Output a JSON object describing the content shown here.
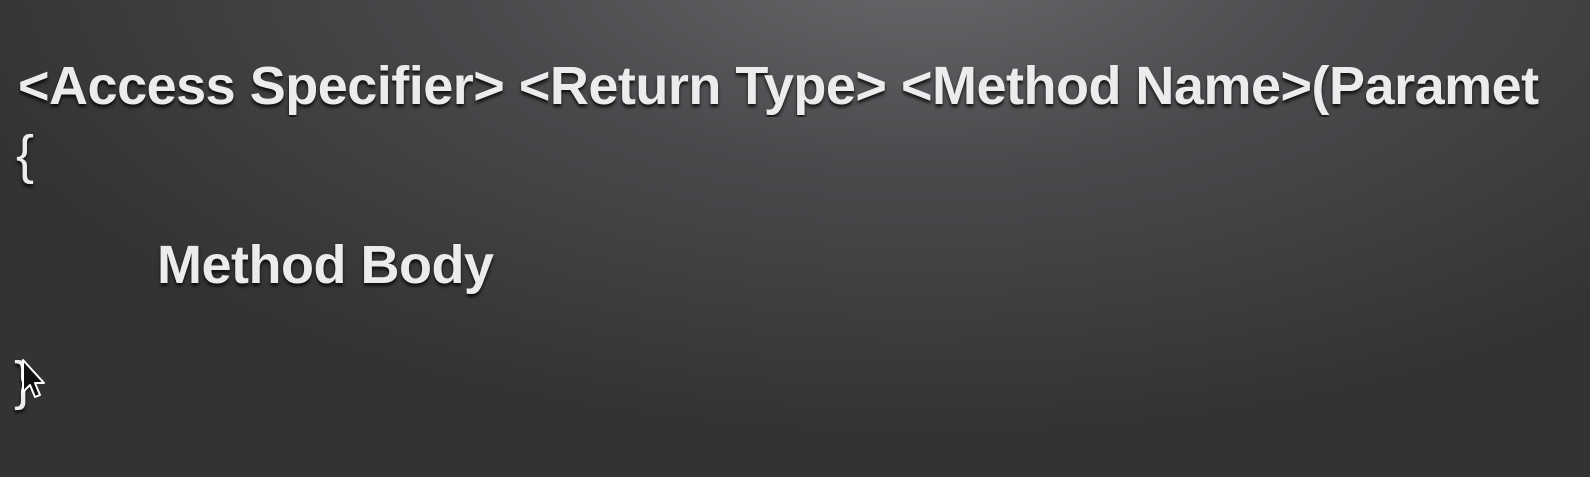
{
  "slide": {
    "signature": "<Access Specifier> <Return Type> <Method Name>(Paramet",
    "open_brace": "{",
    "body": "Method Body",
    "close_brace": "}"
  },
  "cursor": {
    "icon": "arrow-cursor-icon"
  }
}
